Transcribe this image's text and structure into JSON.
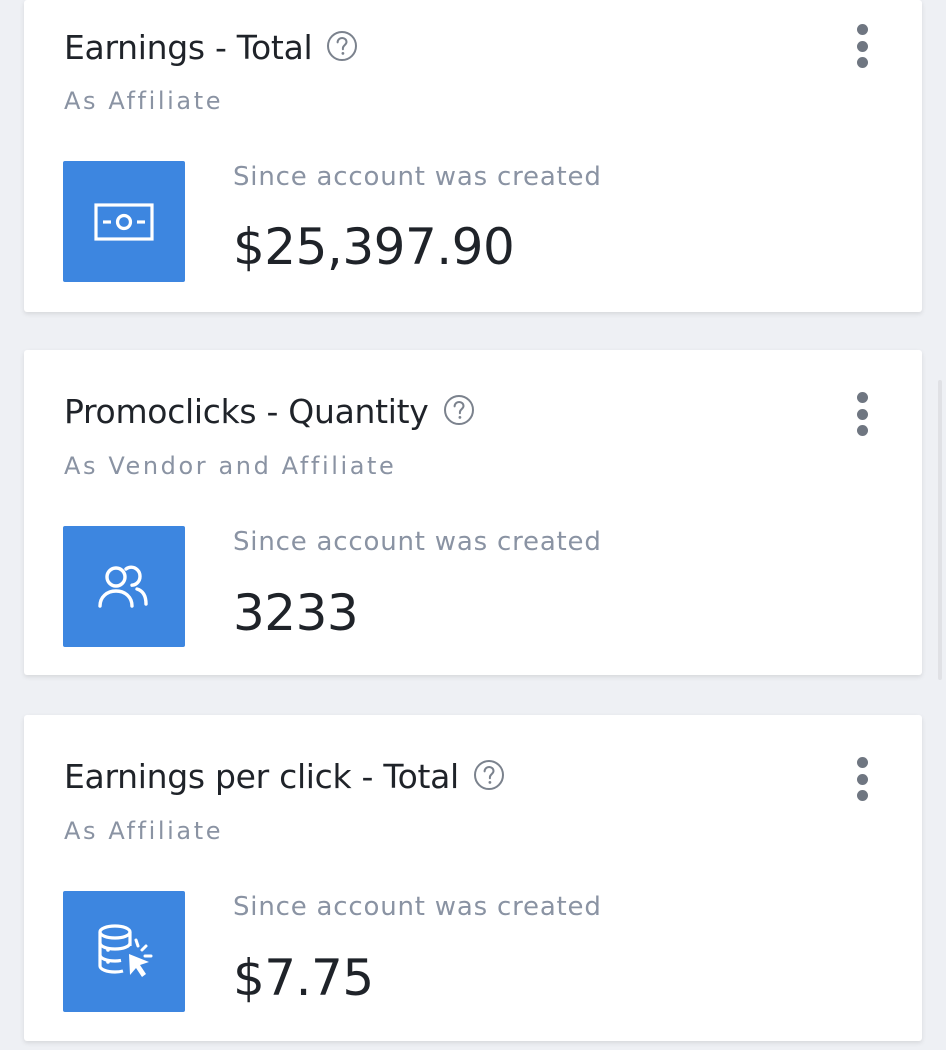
{
  "cards": [
    {
      "title": "Earnings - Total",
      "subtitle": "As Affiliate",
      "period": "Since account was created",
      "value": "$25,397.90",
      "icon": "money-bill-icon"
    },
    {
      "title": "Promoclicks - Quantity",
      "subtitle": "As Vendor and Affiliate",
      "period": "Since account was created",
      "value": "3233",
      "icon": "users-icon"
    },
    {
      "title": "Earnings per click - Total",
      "subtitle": "As Affiliate",
      "period": "Since account was created",
      "value": "$7.75",
      "icon": "database-click-icon"
    }
  ],
  "colors": {
    "accent": "#3d86e0",
    "background": "#eef0f4",
    "card": "#ffffff",
    "title_text": "#1f2329",
    "muted_text": "#8a93a3",
    "menu_dots": "#6f7681"
  }
}
